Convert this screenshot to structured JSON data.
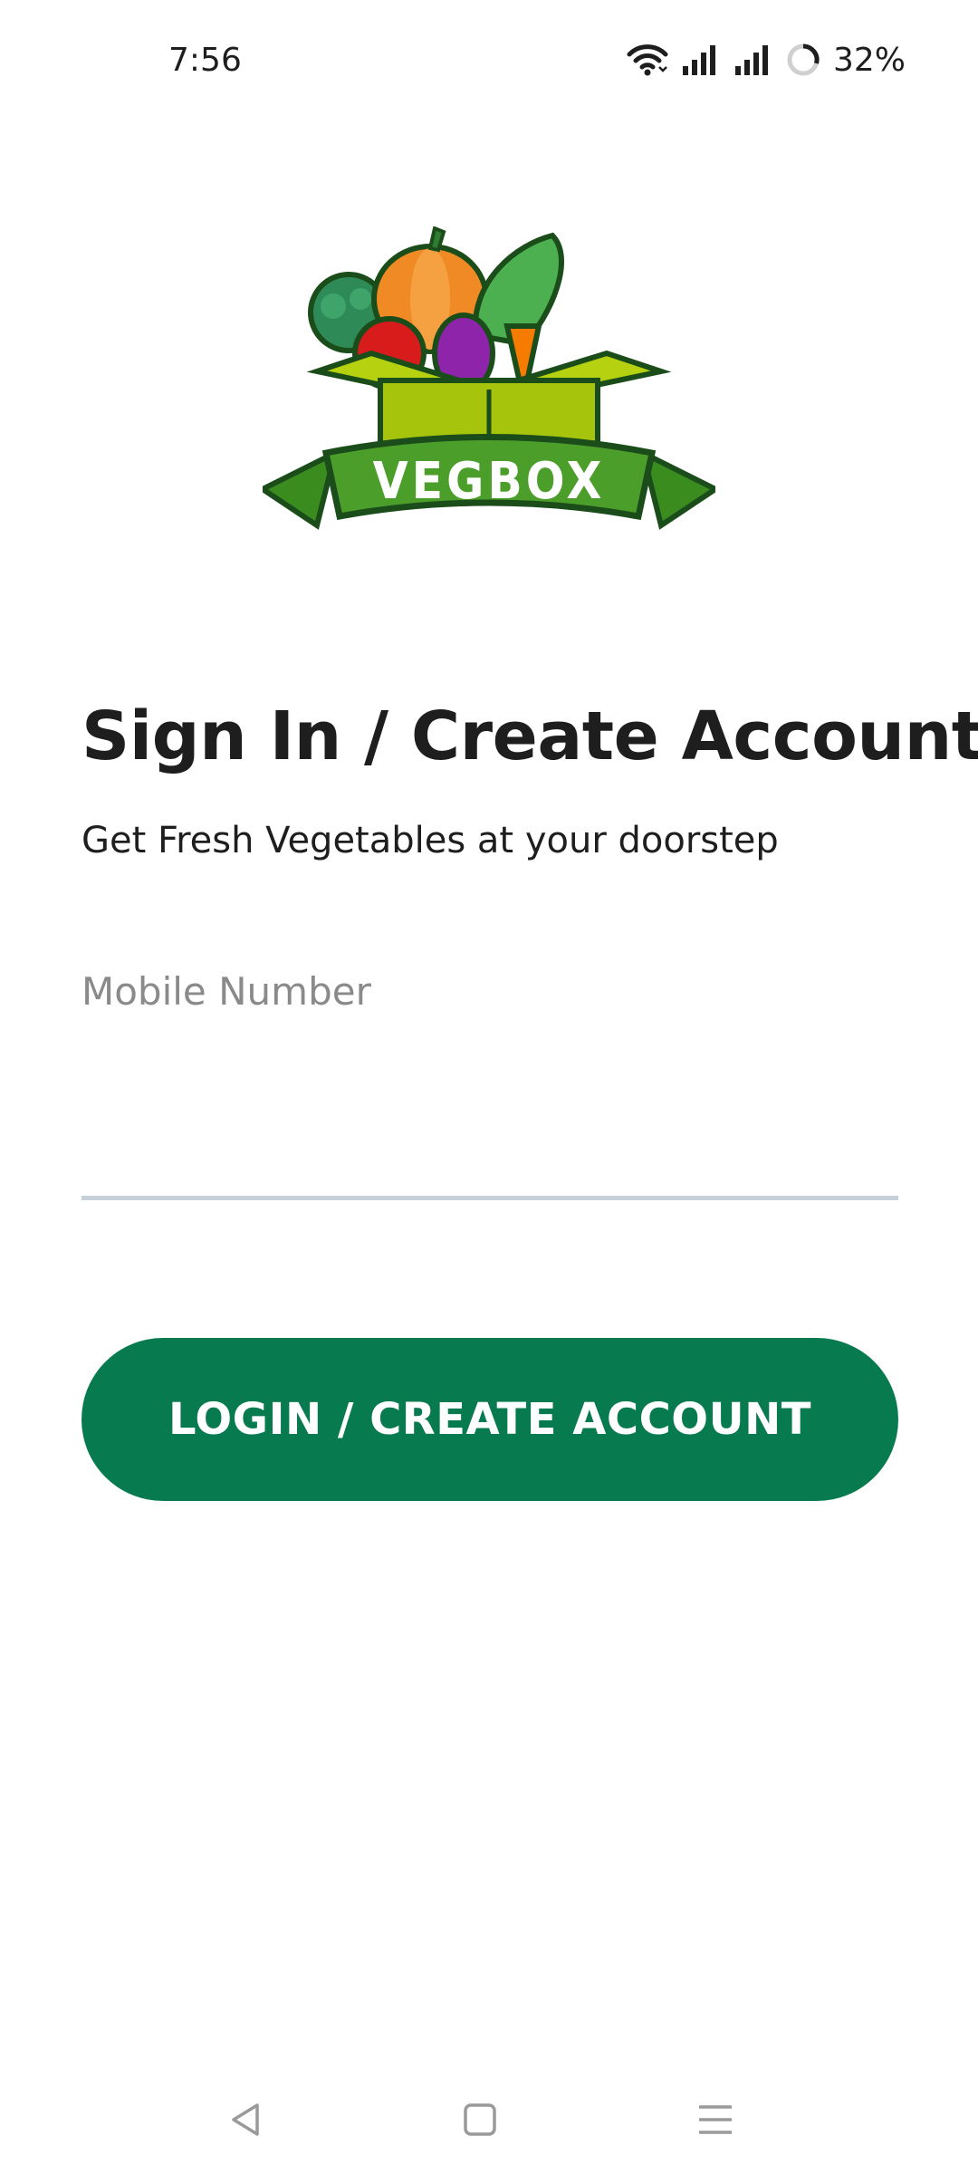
{
  "status_bar": {
    "time": "7:56",
    "battery": "32%",
    "icons": [
      "wifi-icon",
      "signal-icon",
      "signal-icon",
      "battery-icon"
    ]
  },
  "logo": {
    "brand_text": "VEGBOX"
  },
  "header": {
    "title": "Sign In / Create Account",
    "subtitle": "Get Fresh Vegetables at your doorstep"
  },
  "form": {
    "mobile_label": "Mobile Number",
    "mobile_value": ""
  },
  "actions": {
    "login_label": "LOGIN / CREATE ACCOUNT"
  },
  "colors": {
    "primary": "#087a50",
    "underline": "#c5d0d8",
    "label": "#8a8a8a"
  },
  "nav_bar": {
    "icons": [
      "back-icon",
      "home-icon",
      "menu-icon"
    ]
  }
}
